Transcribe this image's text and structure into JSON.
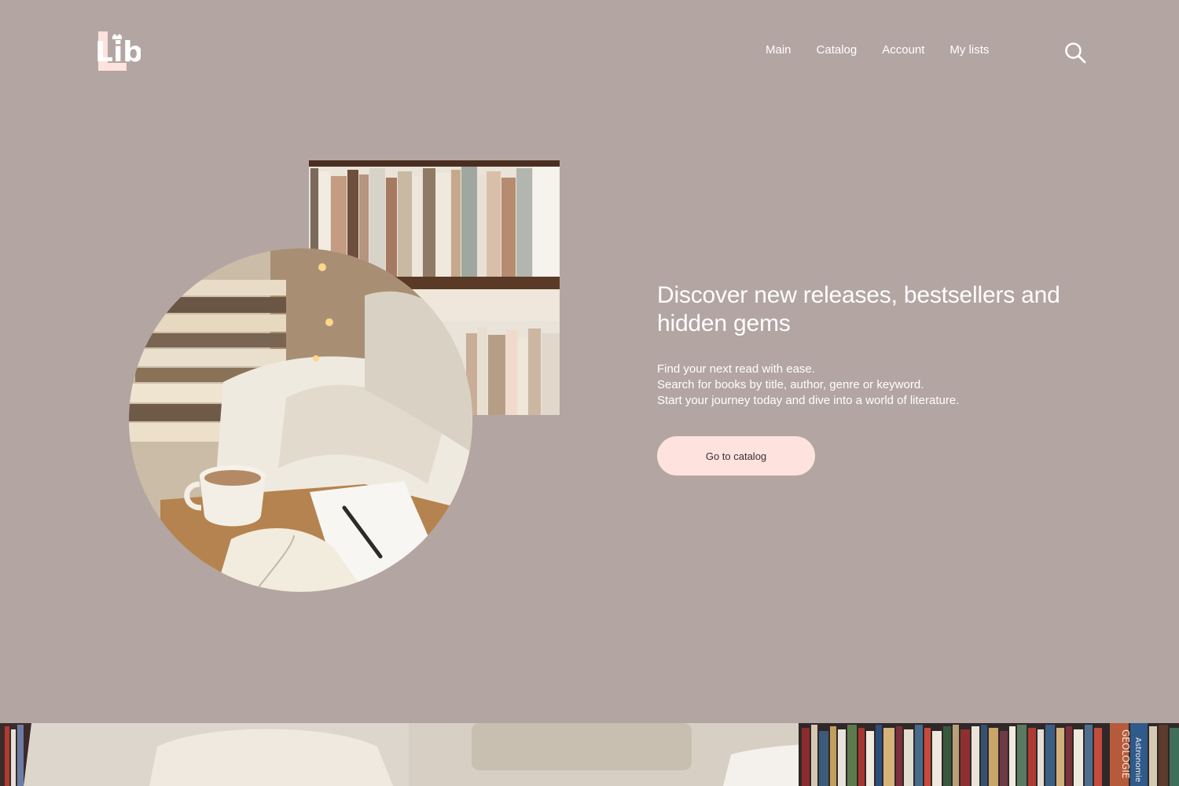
{
  "header": {
    "logo_text": "Lib",
    "nav": [
      {
        "label": "Main"
      },
      {
        "label": "Catalog"
      },
      {
        "label": "Account"
      },
      {
        "label": "My lists"
      }
    ],
    "search_icon": "search-icon"
  },
  "hero": {
    "title": "Discover new releases, bestsellers and hidden gems",
    "lines": [
      "Find your next read with ease.",
      "Search for books by title, author, genre or keyword.",
      "Start your journey today and dive into a world of literature."
    ],
    "cta_label": "Go to catalog"
  },
  "bottom_banner": {
    "spine_texts": [
      "GEOLOGIE",
      "Astronomie"
    ]
  },
  "colors": {
    "background": "#b3a5a2",
    "accent": "#fde2de",
    "text": "#ffffff"
  }
}
